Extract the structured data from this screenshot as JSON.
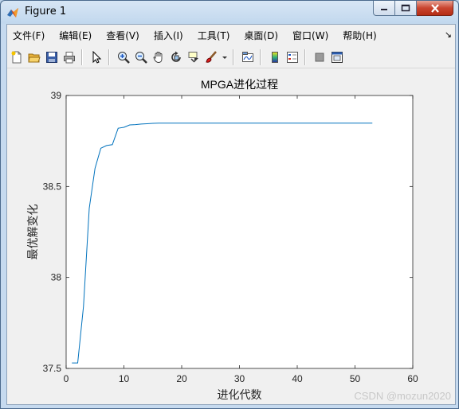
{
  "window": {
    "title": "Figure 1"
  },
  "menubar": {
    "items": [
      {
        "label": "文件(F)"
      },
      {
        "label": "编辑(E)"
      },
      {
        "label": "查看(V)"
      },
      {
        "label": "插入(I)"
      },
      {
        "label": "工具(T)"
      },
      {
        "label": "桌面(D)"
      },
      {
        "label": "窗口(W)"
      },
      {
        "label": "帮助(H)"
      }
    ],
    "expand_glyph": "↘"
  },
  "toolbar": {
    "icons": [
      "new-figure-icon",
      "open-file-icon",
      "save-icon",
      "print-icon",
      "edit-plot-arrow-icon",
      "zoom-in-icon",
      "zoom-out-icon",
      "pan-hand-icon",
      "rotate-3d-icon",
      "data-cursor-icon",
      "brush-icon",
      "insert-colorbar-icon",
      "insert-legend-icon",
      "hide-plot-tools-icon",
      "show-plot-tools-icon",
      "link-plot-icon"
    ]
  },
  "watermark": "CSDN @mozun2020",
  "colors": {
    "line": "#0072bd",
    "axes_bg": "#ffffff",
    "figure_bg": "#f0f0f0"
  },
  "chart_data": {
    "type": "line",
    "title": "MPGA进化过程",
    "xlabel": "进化代数",
    "ylabel": "最优解变化",
    "xlim": [
      0,
      60
    ],
    "ylim": [
      37.5,
      39
    ],
    "xticks": [
      "0",
      "10",
      "20",
      "30",
      "40",
      "50",
      "60"
    ],
    "yticks": [
      "37.5",
      "38",
      "38.5",
      "39"
    ],
    "grid": false,
    "series": [
      {
        "x": [
          1,
          2,
          3,
          4,
          5,
          6,
          7,
          8,
          9,
          10,
          11,
          12,
          13,
          14,
          15,
          16,
          17,
          18,
          19,
          20,
          21,
          22,
          23,
          24,
          25,
          26,
          27,
          28,
          29,
          30,
          31,
          32,
          33,
          34,
          35,
          36,
          37,
          38,
          39,
          40,
          41,
          42,
          43,
          44,
          45,
          46,
          47,
          48,
          49,
          50,
          51,
          52,
          53
        ],
        "values": [
          37.53,
          37.53,
          37.84,
          38.38,
          38.6,
          38.71,
          38.725,
          38.73,
          38.82,
          38.825,
          38.838,
          38.84,
          38.843,
          38.845,
          38.847,
          38.848,
          38.848,
          38.848,
          38.848,
          38.848,
          38.848,
          38.848,
          38.848,
          38.848,
          38.848,
          38.848,
          38.848,
          38.848,
          38.848,
          38.848,
          38.848,
          38.848,
          38.848,
          38.848,
          38.848,
          38.848,
          38.848,
          38.848,
          38.848,
          38.848,
          38.848,
          38.848,
          38.848,
          38.848,
          38.848,
          38.848,
          38.848,
          38.848,
          38.848,
          38.848,
          38.848,
          38.848,
          38.848
        ]
      }
    ]
  }
}
